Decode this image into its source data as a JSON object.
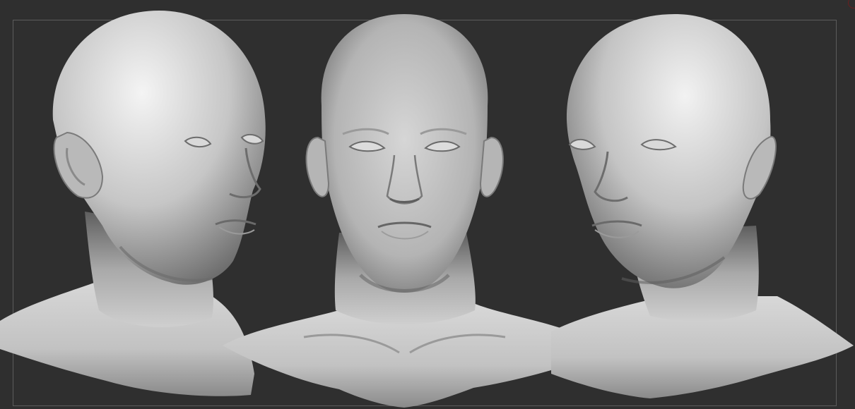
{
  "canvas": {
    "background": "#2f2f2f",
    "guide_frame_color": "#5c5c5c",
    "accent_mark_color": "#6b1f1f"
  },
  "sculpt": {
    "material": "matte grey clay",
    "views": [
      {
        "id": "three-quarter-right",
        "label": ""
      },
      {
        "id": "front",
        "label": ""
      },
      {
        "id": "three-quarter-left",
        "label": ""
      }
    ]
  }
}
